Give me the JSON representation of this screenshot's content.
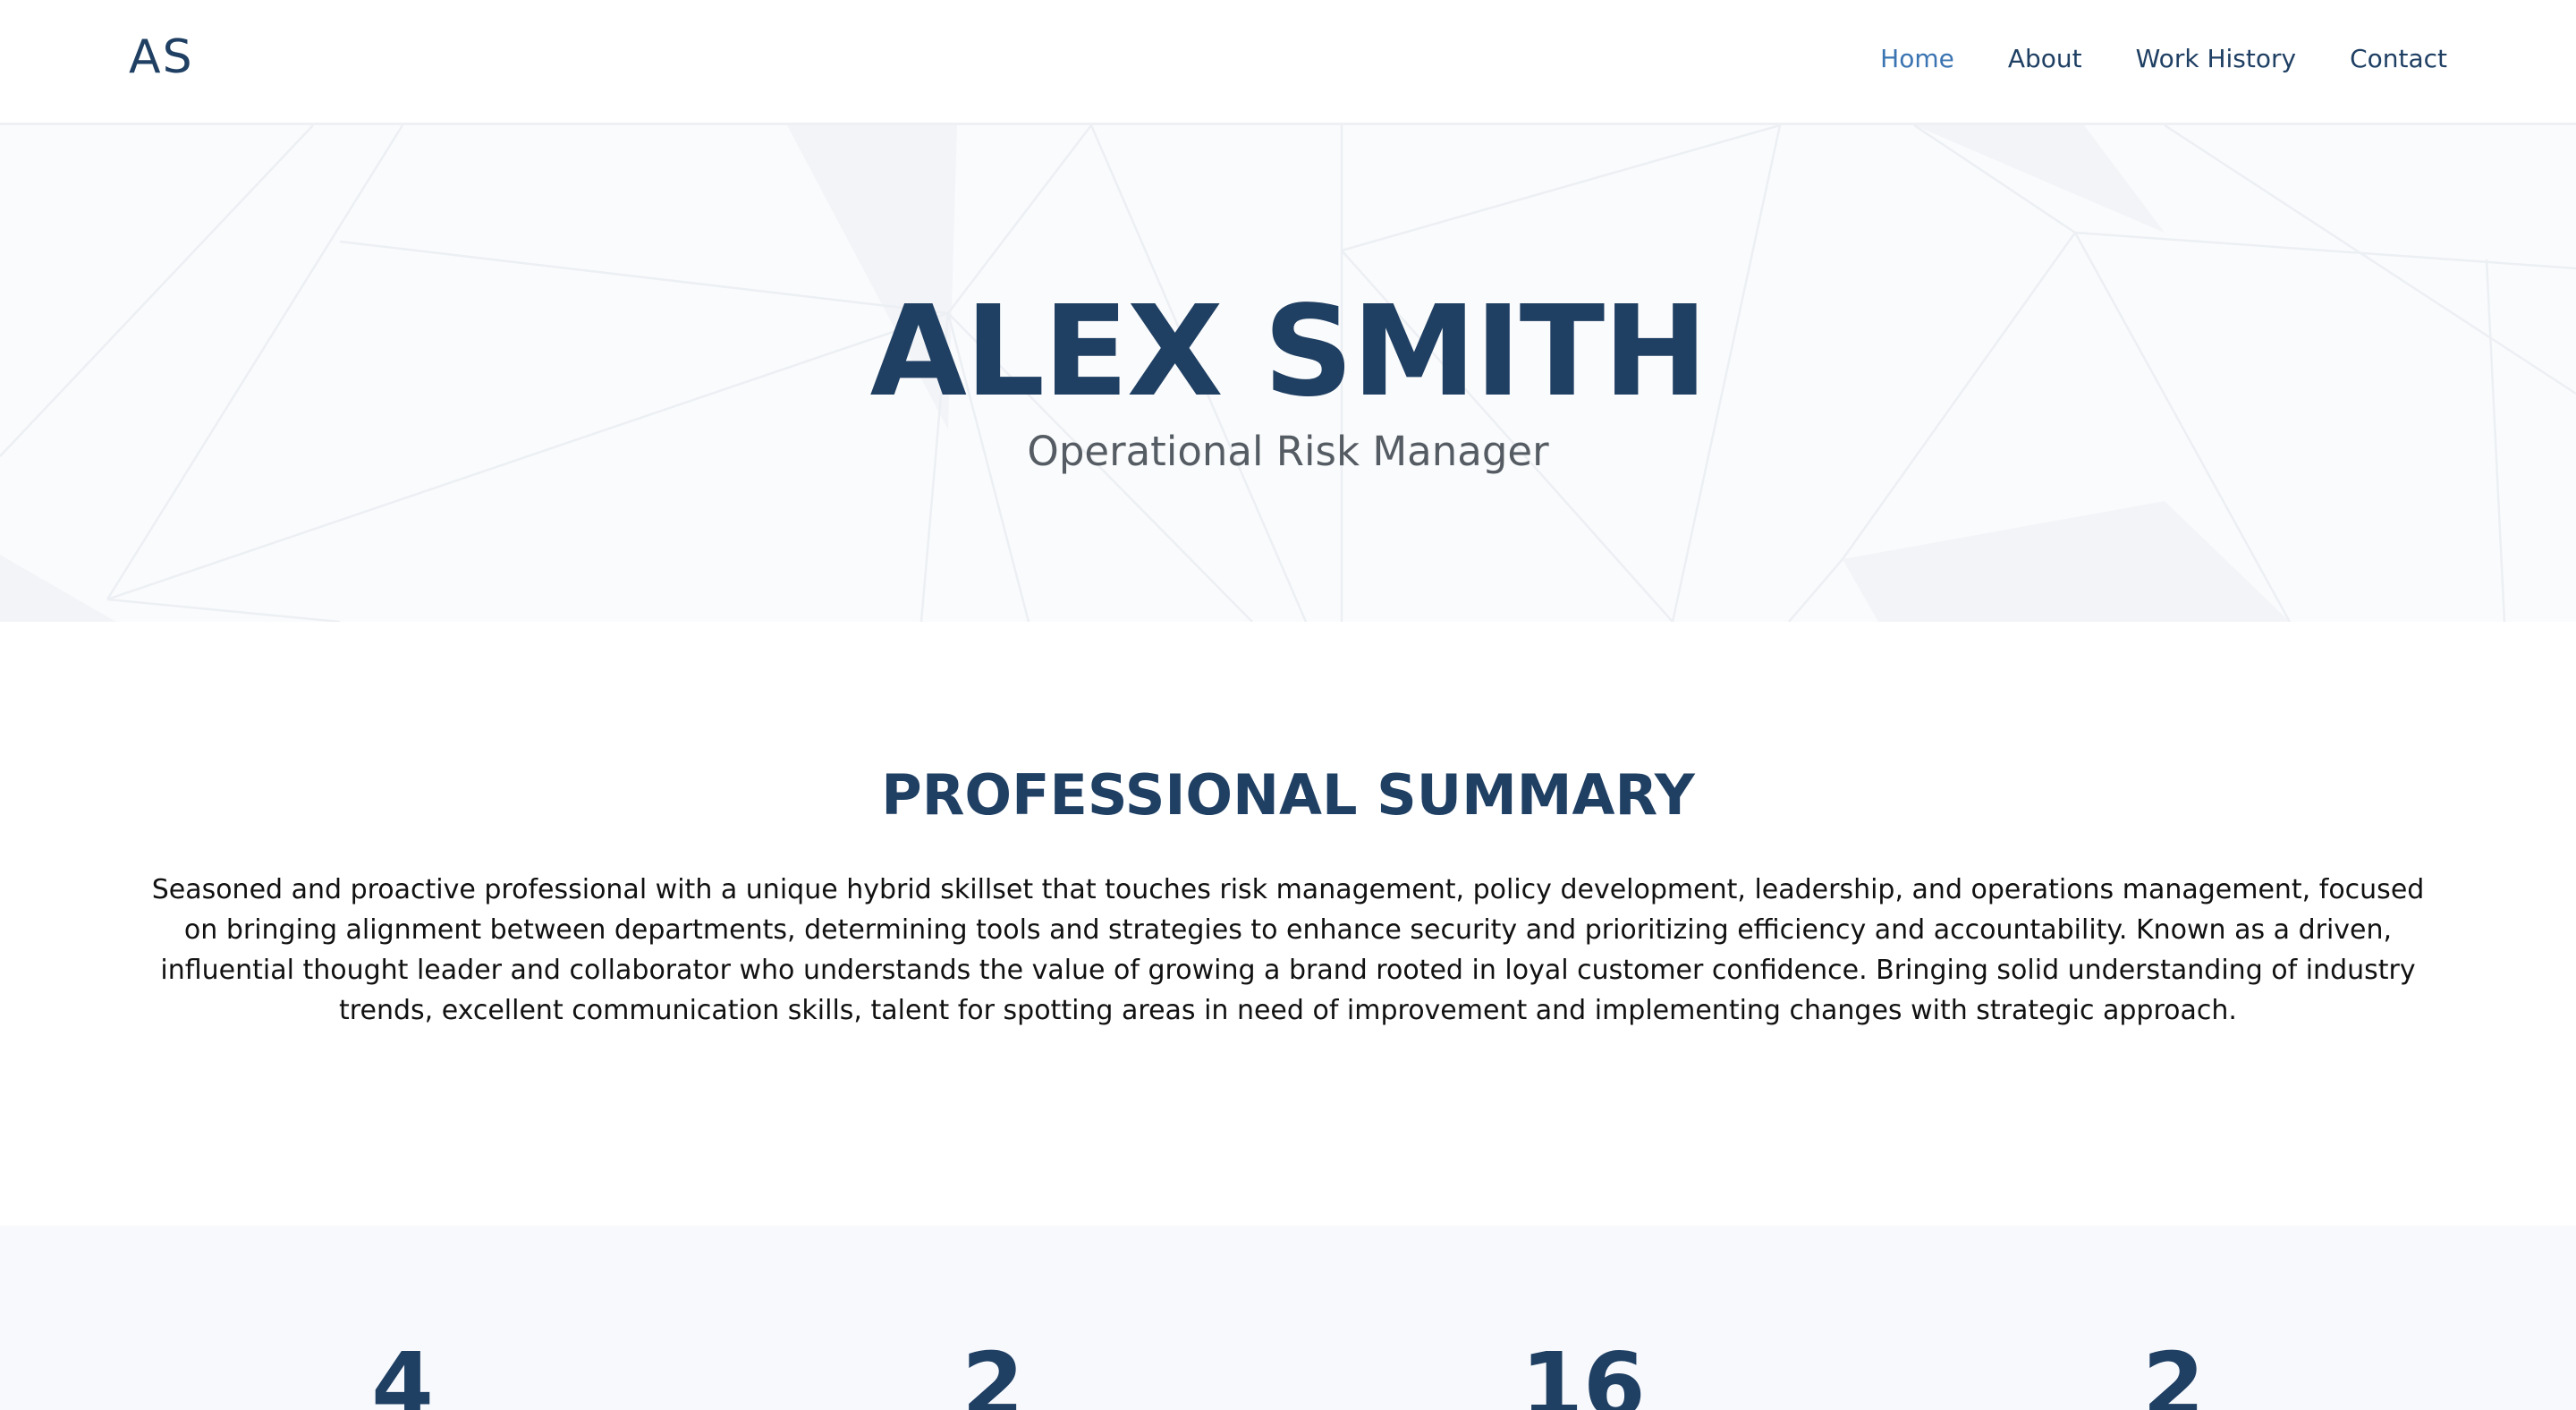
{
  "header": {
    "logo": "AS",
    "nav": [
      {
        "label": "Home",
        "active": true
      },
      {
        "label": "About",
        "active": false
      },
      {
        "label": "Work History",
        "active": false
      },
      {
        "label": "Contact",
        "active": false
      }
    ]
  },
  "hero": {
    "name": "ALEX SMITH",
    "role": "Operational Risk Manager"
  },
  "summary": {
    "title": "PROFESSIONAL SUMMARY",
    "text": "Seasoned and proactive professional with a unique hybrid skillset that touches risk management, policy development, leadership, and operations management, focused on bringing alignment between departments, determining tools and strategies to enhance security and prioritizing efficiency and accountability. Known as a driven, influential thought leader and collaborator who understands the value of growing a brand rooted in loyal customer confidence. Bringing solid understanding of industry trends, excellent communication skills, talent for spotting areas in need of improvement and implementing changes with strategic approach."
  },
  "stats": [
    "4",
    "2",
    "16",
    "2"
  ],
  "colors": {
    "navy": "#1f3f63",
    "active_link": "#3b74b2",
    "subtitle": "#555c63",
    "hero_bg": "#fafbfc",
    "stats_bg": "#f7f9fd"
  }
}
